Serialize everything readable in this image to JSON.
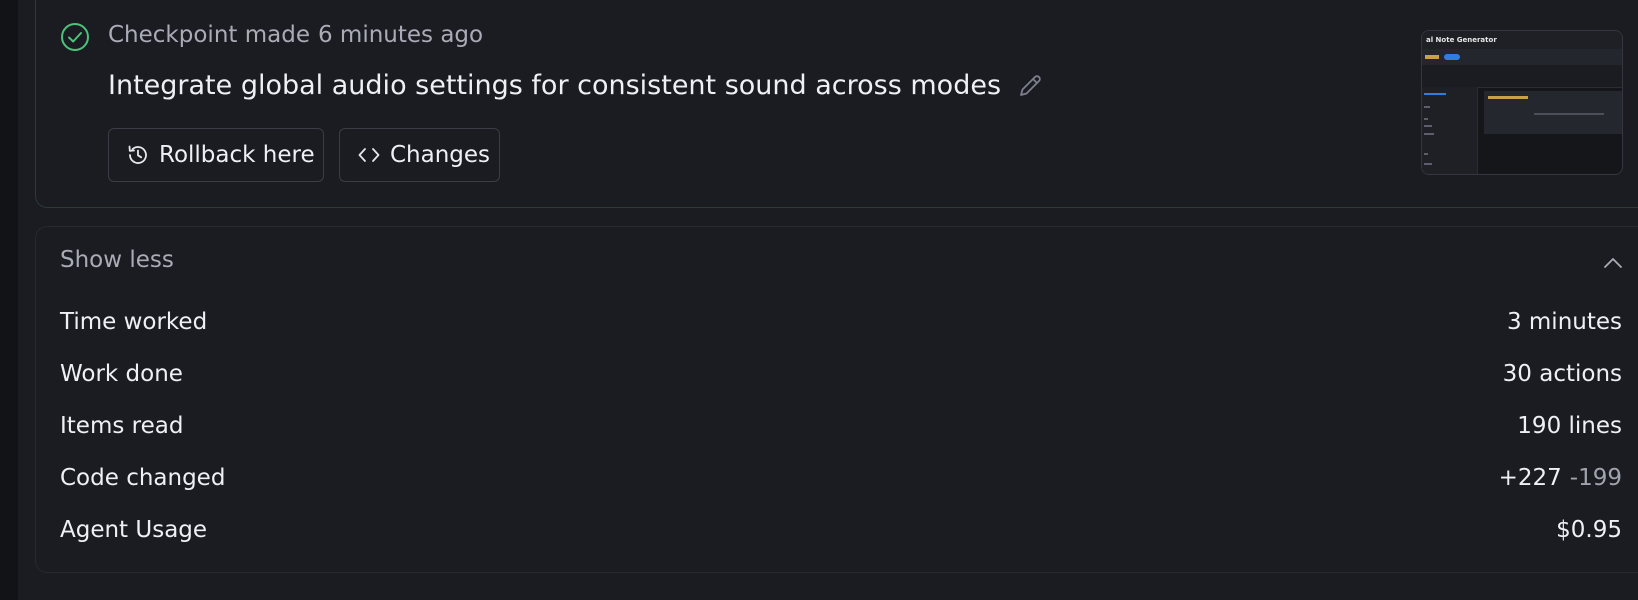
{
  "checkpoint": {
    "label": "Checkpoint made",
    "time": "6 minutes ago",
    "title": "Integrate global audio settings for consistent sound across modes",
    "rollback_label": "Rollback here",
    "changes_label": "Changes",
    "thumbnail_title": "al Note Generator"
  },
  "details": {
    "toggle_label": "Show less",
    "stats": [
      {
        "label": "Time worked",
        "value": "3 minutes"
      },
      {
        "label": "Work done",
        "value": "30 actions"
      },
      {
        "label": "Items read",
        "value": "190 lines"
      },
      {
        "label": "Code changed",
        "added": "+227",
        "removed": "-199"
      },
      {
        "label": "Agent Usage",
        "value": "$0.95"
      }
    ]
  },
  "colors": {
    "success": "#4cc27a",
    "muted_text": "#a9acb7",
    "background": "#1a1c22"
  }
}
